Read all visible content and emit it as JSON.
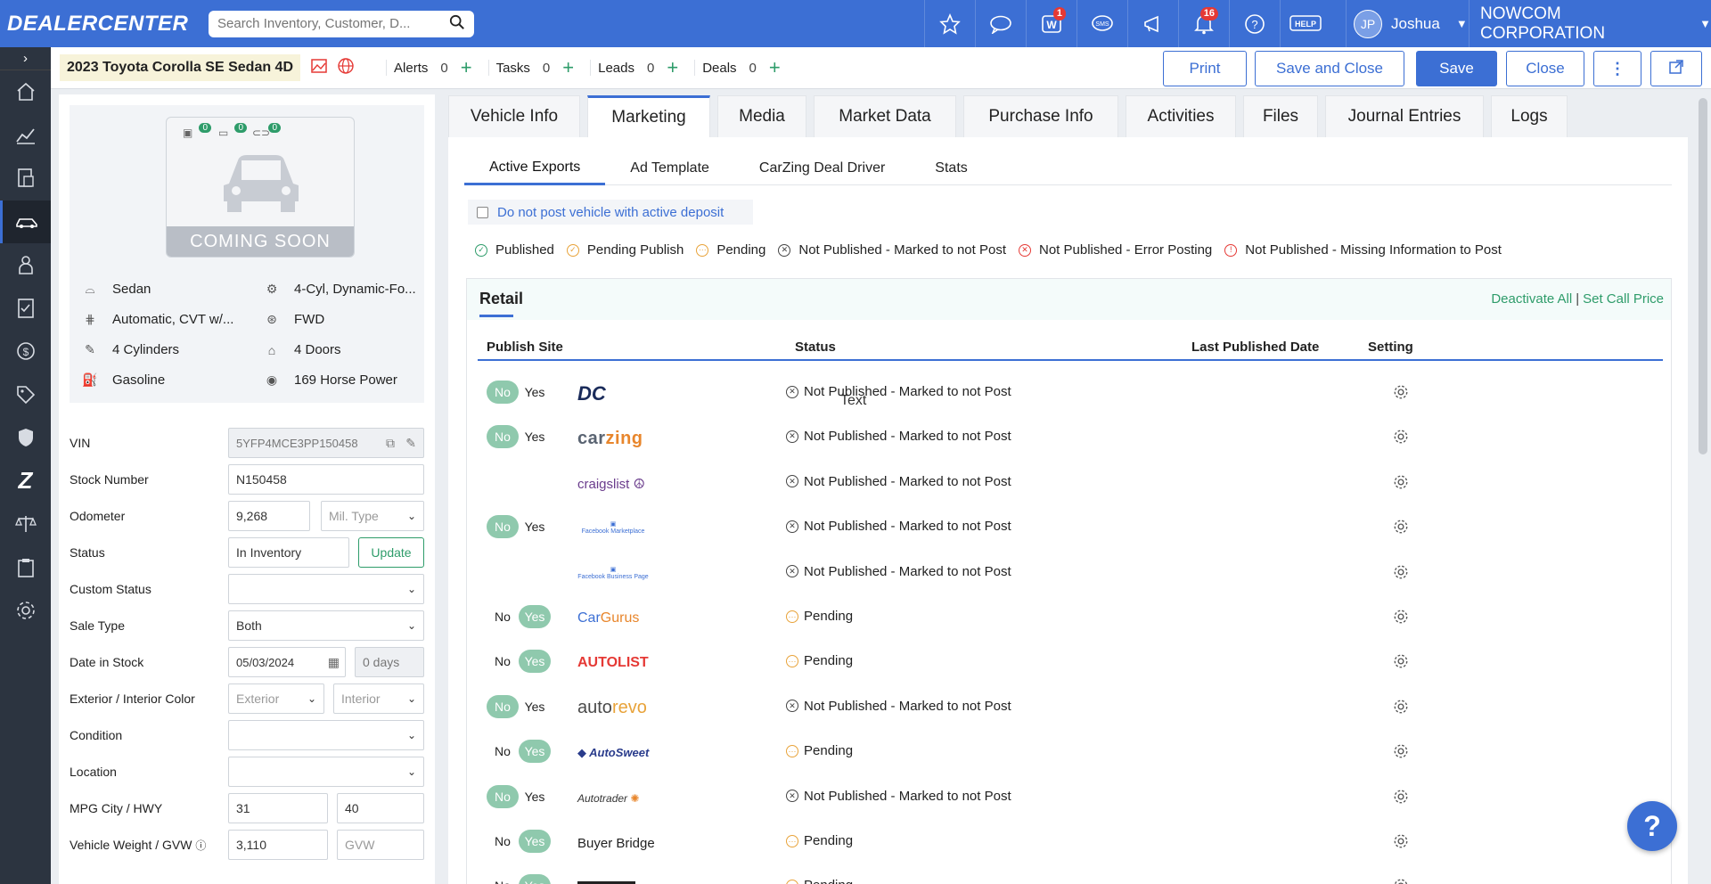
{
  "topbar": {
    "logo": "DEALERCENTER",
    "search_placeholder": "Search Inventory, Customer, D...",
    "icons": [
      {
        "name": "star-icon",
        "badge": ""
      },
      {
        "name": "chat-icon",
        "badge": ""
      },
      {
        "name": "w-icon",
        "badge": "1"
      },
      {
        "name": "sms-icon",
        "badge": ""
      },
      {
        "name": "megaphone-icon",
        "badge": ""
      },
      {
        "name": "bell-icon",
        "badge": "16"
      },
      {
        "name": "question-icon",
        "badge": ""
      },
      {
        "name": "help-icon",
        "badge": ""
      }
    ],
    "help_label": "HELP",
    "sms_label": "SMS",
    "user_initials": "JP",
    "user_name": "Joshua",
    "corporation": "NOWCOM CORPORATION"
  },
  "sidebar": {
    "items": [
      "home-icon",
      "chart-icon",
      "document-icon",
      "car-icon",
      "person-icon",
      "checklist-icon",
      "money-icon",
      "tag-icon",
      "shield-icon",
      "z-icon",
      "scale-icon",
      "clipboard-icon",
      "gear-icon"
    ],
    "active_index": 3
  },
  "subheader": {
    "vehicle_title": "2023 Toyota Corolla SE Sedan 4D",
    "counters": [
      {
        "label": "Alerts",
        "value": "0"
      },
      {
        "label": "Tasks",
        "value": "0"
      },
      {
        "label": "Leads",
        "value": "0"
      },
      {
        "label": "Deals",
        "value": "0"
      }
    ],
    "buttons": {
      "print": "Print",
      "save_close": "Save and Close",
      "save": "Save",
      "close": "Close"
    }
  },
  "vehicle": {
    "photo_counts": [
      "0",
      "0",
      "0"
    ],
    "coming_soon": "COMING SOON",
    "specs": [
      {
        "icon": "body-icon",
        "text": "Sedan"
      },
      {
        "icon": "engine-icon",
        "text": "4-Cyl, Dynamic-Fo..."
      },
      {
        "icon": "transmission-icon",
        "text": "Automatic, CVT w/..."
      },
      {
        "icon": "drivetrain-icon",
        "text": "FWD"
      },
      {
        "icon": "cylinder-icon",
        "text": "4 Cylinders"
      },
      {
        "icon": "door-icon",
        "text": "4 Doors"
      },
      {
        "icon": "fuel-icon",
        "text": "Gasoline"
      },
      {
        "icon": "horsepower-icon",
        "text": "169 Horse Power"
      }
    ],
    "fields": {
      "vin_label": "VIN",
      "vin": "5YFP4MCE3PP150458",
      "stock_label": "Stock Number",
      "stock": "N150458",
      "odometer_label": "Odometer",
      "odometer": "9,268",
      "mil_type": "Mil. Type",
      "status_label": "Status",
      "status": "In Inventory",
      "update": "Update",
      "custom_status_label": "Custom Status",
      "custom_status": "",
      "sale_type_label": "Sale Type",
      "sale_type": "Both",
      "date_label": "Date in Stock",
      "date": "05/03/2024",
      "days": "0 days",
      "color_label": "Exterior / Interior Color",
      "exterior": "Exterior",
      "interior": "Interior",
      "condition_label": "Condition",
      "condition": "",
      "location_label": "Location",
      "location": "",
      "mpg_label": "MPG City / HWY",
      "mpg_city": "31",
      "mpg_hwy": "40",
      "weight_label": "Vehicle Weight / GVW",
      "weight": "3,110",
      "gvw": "GVW"
    }
  },
  "tabs": [
    "Vehicle Info",
    "Marketing",
    "Media",
    "Market Data",
    "Purchase Info",
    "Activities",
    "Files",
    "Journal Entries",
    "Logs"
  ],
  "active_tab": "Marketing",
  "subtabs": [
    "Active Exports",
    "Ad Template",
    "CarZing Deal Driver",
    "Stats"
  ],
  "deposit_label": "Do not post vehicle with active deposit",
  "legend": [
    {
      "label": "Published",
      "color": "#2e9c6a",
      "glyph": "✓"
    },
    {
      "label": "Pending Publish",
      "color": "#e8a33a",
      "glyph": "✓"
    },
    {
      "label": "Pending",
      "color": "#e8a33a",
      "glyph": "···"
    },
    {
      "label": "Not Published - Marked to not Post",
      "color": "#444444",
      "glyph": "✕"
    },
    {
      "label": "Not Published - Error Posting",
      "color": "#e53935",
      "glyph": "✕"
    },
    {
      "label": "Not Published - Missing Information to Post",
      "color": "#e53935",
      "glyph": "!"
    }
  ],
  "retail": {
    "title": "Retail",
    "deactivate_all": "Deactivate All",
    "set_call_price": "Set Call Price",
    "columns": [
      "Publish Site",
      "Status",
      "Last Published Date",
      "Setting"
    ],
    "float_text": "Text",
    "rows": [
      {
        "site": "DC",
        "toggle": "no",
        "status": "Not Published - Marked to not Post",
        "kind": "marked"
      },
      {
        "site": "carzing",
        "toggle": "no",
        "status": "Not Published - Marked to not Post",
        "kind": "marked"
      },
      {
        "site": "craigslist",
        "toggle": "none",
        "status": "Not Published - Marked to not Post",
        "kind": "marked"
      },
      {
        "site": "Facebook Marketplace",
        "toggle": "no",
        "status": "Not Published - Marked to not Post",
        "kind": "marked"
      },
      {
        "site": "Facebook Business Page",
        "toggle": "none",
        "status": "Not Published - Marked to not Post",
        "kind": "marked"
      },
      {
        "site": "CarGurus",
        "toggle": "yes",
        "status": "Pending",
        "kind": "pending"
      },
      {
        "site": "AUTOLIST",
        "toggle": "yes",
        "status": "Pending",
        "kind": "pending"
      },
      {
        "site": "autorevo",
        "toggle": "no",
        "status": "Not Published - Marked to not Post",
        "kind": "marked"
      },
      {
        "site": "AutoSweet",
        "toggle": "yes",
        "status": "Pending",
        "kind": "pending"
      },
      {
        "site": "Autotrader",
        "toggle": "no",
        "status": "Not Published - Marked to not Post",
        "kind": "marked"
      },
      {
        "site": "Buyer Bridge",
        "toggle": "yes",
        "status": "Pending",
        "kind": "pending"
      },
      {
        "site": "CARFAX",
        "toggle": "yes",
        "status": "Pending",
        "kind": "pending"
      }
    ],
    "no_label": "No",
    "yes_label": "Yes"
  },
  "help_fab": "?"
}
